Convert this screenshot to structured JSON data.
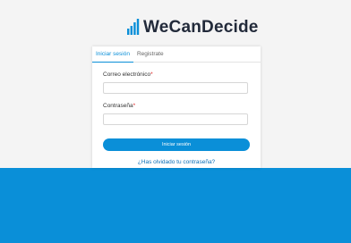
{
  "brand": {
    "name": "WeCanDecide",
    "logo_icon": "bar-chart-logo-icon",
    "accent_color": "#0a8fd8"
  },
  "auth_card": {
    "tabs": [
      {
        "label": "Iniciar sesión",
        "active": true
      },
      {
        "label": "Registrate",
        "active": false
      }
    ],
    "email": {
      "label": "Correo electrónico",
      "required_marker": "*",
      "value": "",
      "placeholder": ""
    },
    "password": {
      "label": "Contraseña",
      "required_marker": "*",
      "value": "",
      "placeholder": ""
    },
    "submit_label": "Iniciar sesión",
    "forgot_password_label": "¿Has olvidado tu contraseña?"
  }
}
